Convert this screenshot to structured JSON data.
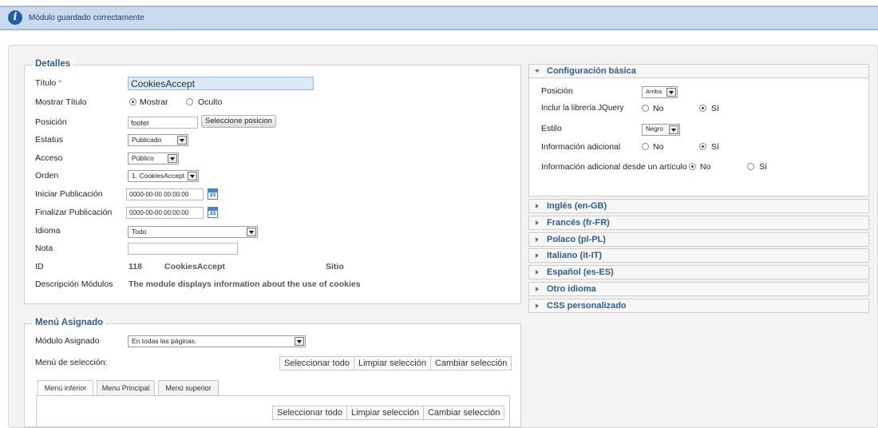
{
  "message": {
    "icon": "info-icon",
    "text": "Módulo guardado correctamente"
  },
  "details": {
    "legend": "Detalles",
    "title_label": "Título",
    "required_mark": "*",
    "title_value": "CookiesAccept",
    "show_title_label": "Mostrar Título",
    "show_option": "Mostrar",
    "hide_option": "Oculto",
    "position_label": "Posición",
    "position_value": "footer",
    "position_button": "Seleccione posicion",
    "status_label": "Estatus",
    "status_value": "Publicado",
    "access_label": "Acceso",
    "access_value": "Público",
    "order_label": "Orden",
    "order_value": "1. CookiesAccept",
    "start_label": "Iniciar Publicación",
    "start_value": "0000-00-00 00:00:00",
    "finish_label": "Finalizar Publicación",
    "finish_value": "0000-00-00 00:00:00",
    "calendar_day": "23",
    "language_label": "Idioma",
    "language_value": "Todo",
    "note_label": "Nota",
    "note_value": "",
    "id_label": "ID",
    "id_value": "118",
    "module_name": "CookiesAccept",
    "site": "Sitio",
    "description_label": "Descripción Módulos",
    "description_value": "The module displays information about the use of cookies"
  },
  "menu": {
    "legend": "Menú Asignado",
    "assigned_label": "Módulo Asignado",
    "assigned_value": "En todas las páginas.",
    "selection_label": "Menú de selección:",
    "buttons": [
      "Seleccionar todo",
      "Limpiar selección",
      "Cambiar selección"
    ],
    "tabs": [
      "Menú inferior",
      "Menu Principal",
      "Menú superior"
    ]
  },
  "basic": {
    "header": "Configuración básica",
    "position_label": "Posición",
    "position_value": "Arriba",
    "jquery_label": "Inclur la librería JQuery",
    "no": "No",
    "yes": "Sí",
    "style_label": "Estilo",
    "style_value": "Negro",
    "additional_label": "Información adicional",
    "article_label": "Información adicional desde un artículo"
  },
  "accordion": [
    "Inglés (en-GB)",
    "Francés (fr-FR)",
    "Polaco (pl-PL)",
    "Italiano (it-IT)",
    "Español (es-ES)",
    "Otro idioma",
    "CSS personalizado"
  ]
}
